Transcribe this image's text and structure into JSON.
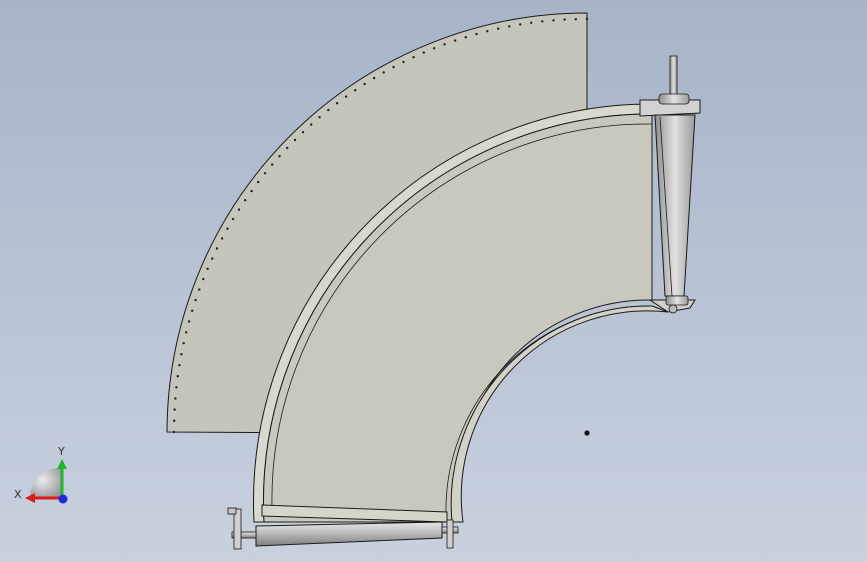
{
  "viewport": {
    "background_top": "#a7b4c8",
    "background_bottom": "#c9d1de"
  },
  "model": {
    "flat_blank_fill": "#c6c5bb",
    "conveyor_fill": "#c9c8be",
    "frame_stroke": "#1a1a1a",
    "roller_light": "#d8d8d8",
    "roller_dark": "#8c8c8c",
    "holes_color": "#222222"
  },
  "triad": {
    "x_label": "X",
    "y_label": "Y",
    "x_color": "#d91c1c",
    "y_color": "#1fb52a",
    "z_color": "#1f2bd6"
  }
}
